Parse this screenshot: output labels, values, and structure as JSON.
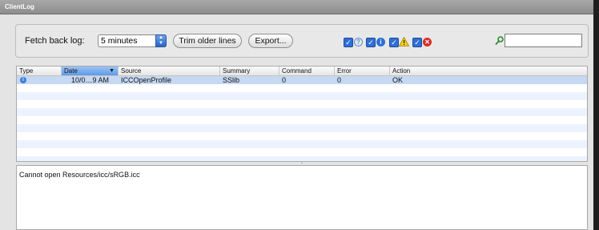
{
  "window": {
    "title": "ClientLog"
  },
  "toolbar": {
    "fetch_label": "Fetch back log:",
    "fetch_value": "5 minutes",
    "trim_label": "Trim older lines",
    "export_label": "Export...",
    "search_value": ""
  },
  "filters": [
    {
      "type": "debug",
      "checked": true,
      "icon": "question-icon"
    },
    {
      "type": "info",
      "checked": true,
      "icon": "info-icon"
    },
    {
      "type": "warning",
      "checked": true,
      "icon": "warning-icon"
    },
    {
      "type": "error",
      "checked": true,
      "icon": "error-icon"
    }
  ],
  "table": {
    "columns": [
      "Type",
      "Date",
      "Source",
      "Summary",
      "Command",
      "Error",
      "Action"
    ],
    "sorted_column": "Date",
    "rows": [
      {
        "type_icon": "info-icon",
        "date": "10/0…9 AM",
        "source": "ICCOpenProfile",
        "summary": "SSlib",
        "command": "0",
        "error": "0",
        "action": "OK"
      }
    ]
  },
  "detail": {
    "message": "Cannot open Resources/icc/sRGB.icc"
  },
  "colors": {
    "selection": "#c6d8f2",
    "alt_row": "#edf3fe",
    "title_bar": "#9b9b9b"
  }
}
